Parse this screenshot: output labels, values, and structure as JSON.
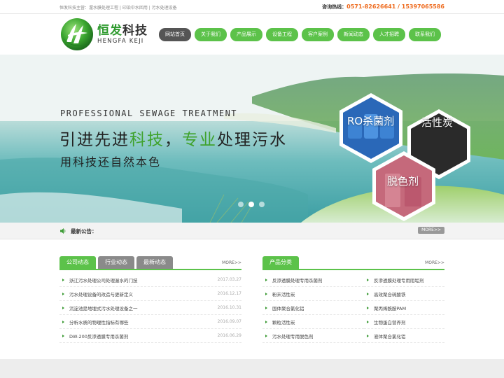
{
  "topbar": {
    "tagline": "恒发科技主营：渥水膜处理工程 | 印染中水回用 | 污水处理设备",
    "hotline_label": "咨询热线：",
    "hotline_numbers": "0571-82626641 / 15397065586"
  },
  "header": {
    "logo_cn_main": "恒发",
    "logo_cn_accent": "科技",
    "logo_en": "HENGFA KEJI",
    "brand_color": "#2e9a2e"
  },
  "nav": [
    {
      "label": "网站首页",
      "active": true
    },
    {
      "label": "关于我们",
      "active": false
    },
    {
      "label": "产品展示",
      "active": false
    },
    {
      "label": "设备工程",
      "active": false
    },
    {
      "label": "客户案例",
      "active": false
    },
    {
      "label": "新闻动态",
      "active": false
    },
    {
      "label": "人才招聘",
      "active": false
    },
    {
      "label": "联系我们",
      "active": false
    }
  ],
  "banner": {
    "en_title": "PROFESSIONAL SEWAGE TREATMENT",
    "line1_a": "引进先进",
    "line1_b": "科技",
    "line1_c": "，",
    "line1_d": "专业",
    "line1_e": "处理污水",
    "line2": "用科技还自然本色",
    "hex1": "RO杀菌剂",
    "hex2": "活性炭",
    "hex3": "脱色剂",
    "slide_count": 3,
    "active_slide": 1
  },
  "notice": {
    "label": "最新公告：",
    "more": "MORE>>"
  },
  "news": {
    "tabs": [
      "公司动态",
      "行业动态",
      "最新动态"
    ],
    "more": "MORE>>",
    "items": [
      {
        "title": "浙江污水处理公司处理渥水的门技",
        "date": "2017.03.27"
      },
      {
        "title": "污水处理设备的改造与更新定义",
        "date": "2016.12.17"
      },
      {
        "title": "沉淀池是地埋式污水处理设备之一",
        "date": "2016.10.31"
      },
      {
        "title": "分析水质的物理性指标有哪些",
        "date": "2016.09.07"
      },
      {
        "title": "DW-200反渗透膜专用杀菌剂",
        "date": "2016.06.29"
      }
    ]
  },
  "products": {
    "tab": "产品分类",
    "more": "MORE>>",
    "items": [
      "反渗透膜处理专用杀菌剂",
      "反渗透膜处理专用阻垢剂",
      "粉末活性炭",
      "高效聚合硫酸铁",
      "固体聚合氯化铝",
      "聚丙烯酰胺PAM",
      "颗粒活性炭",
      "生物蛋白营养剂",
      "污水处理专用脱色剂",
      "液体聚合氯化铝"
    ]
  },
  "colors": {
    "accent_green": "#5cc24a",
    "hotline_orange": "#ee6a1d",
    "tab_gray": "#8a8a8a"
  }
}
